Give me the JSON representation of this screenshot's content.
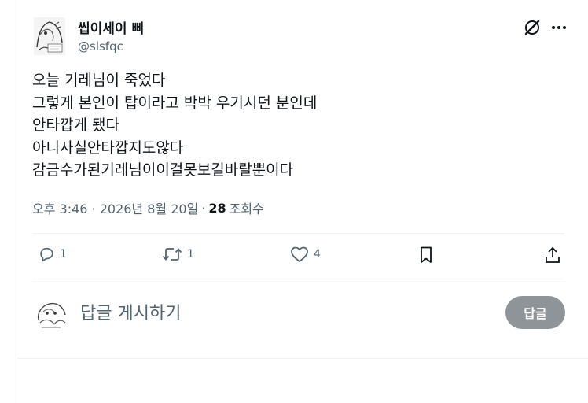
{
  "author": {
    "display_name": "씹이세이 삐",
    "handle": "@slsfqc",
    "avatar_icon": "ink-sketch-avatar"
  },
  "tweet": {
    "lines": [
      "오늘 기레님이 죽었다",
      "그렇게 본인이 탑이라고 박박 우기시던 분인데",
      "안타깝게 됐다",
      "아니사실안타깝지도않다",
      "감금수가된기레님이이걸못보길바랄뿐이다"
    ]
  },
  "meta": {
    "timestamp": "오후 3:46 · 2026년 8월 20일",
    "separator": "·",
    "views_count": "28",
    "views_label": "조회수"
  },
  "actions": {
    "reply_count": "1",
    "retweet_count": "1",
    "like_count": "4"
  },
  "compose": {
    "placeholder": "답글 게시하기",
    "button_label": "답글"
  },
  "icons": [
    "grok-icon",
    "more-icon",
    "reply-icon",
    "retweet-icon",
    "like-icon",
    "bookmark-icon",
    "share-icon"
  ],
  "colors": {
    "text": "#0f1419",
    "secondary": "#536471",
    "button_disabled": "#8f9499",
    "divider": "#eff3f4"
  }
}
